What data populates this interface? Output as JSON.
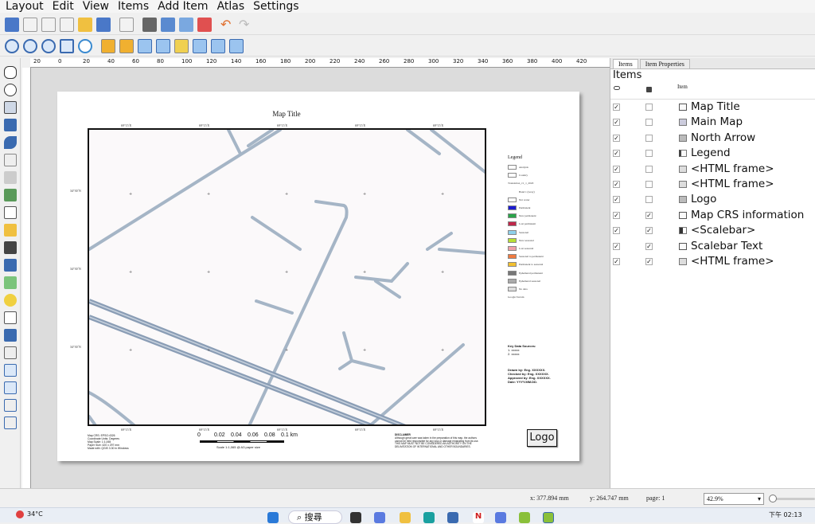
{
  "menu": [
    "Layout",
    "Edit",
    "View",
    "Items",
    "Add Item",
    "Atlas",
    "Settings"
  ],
  "layout": {
    "map_title": "Map Title",
    "top_ticks": [
      "69°15´E",
      "69°15´E",
      "69°15´E",
      "69°15´E",
      "69°15´E"
    ],
    "bottom_ticks": [
      "69°15´E",
      "69°15´E",
      "69°15´E",
      "69°15´E",
      "69°15´E"
    ],
    "left_ticks": [
      "34°30´N",
      "34°30´N",
      "34°30´N"
    ],
    "legend_title": "Legend",
    "legend_items": [
      {
        "label": "Analysis",
        "color": "#ffffff"
      },
      {
        "label": "Country",
        "color": "#ffffff"
      },
      {
        "label": "Translation_v1_1_2020",
        "color": ""
      },
      {
        "label": "Band 1 (Gray)",
        "color": ""
      },
      {
        "label": "Not water",
        "color": "#ffffff"
      },
      {
        "label": "Permanent",
        "color": "#1a1ad0"
      },
      {
        "label": "New permanent",
        "color": "#2aa44a"
      },
      {
        "label": "Lost permanent",
        "color": "#c0274a"
      },
      {
        "label": "Seasonal",
        "color": "#8ed0ea"
      },
      {
        "label": "New seasonal",
        "color": "#b8e034"
      },
      {
        "label": "Lost seasonal",
        "color": "#f0a0a8"
      },
      {
        "label": "Seasonal to permanent",
        "color": "#f07a40"
      },
      {
        "label": "Permanent to seasonal",
        "color": "#f2c030"
      },
      {
        "label": "Ephemeral permanent",
        "color": "#777777"
      },
      {
        "label": "Ephemeral seasonal",
        "color": "#aaaaaa"
      },
      {
        "label": "No data",
        "color": "#dddddd"
      },
      {
        "label": "Google Terrain",
        "color": ""
      }
    ],
    "key_sources_title": "Key Data Sources:",
    "key_sources": [
      "1. xxxxx",
      "2. xxxxx"
    ],
    "credits": [
      "Drawn by: Eng. XXXXXX.",
      "Checked by: Eng. XXXXXX.",
      "Approved by: Eng. XXXXXX.",
      "Date: YYYY.MM.DD."
    ],
    "crs_info": [
      "Map CRS: EPSG:4326",
      "Coordinate Units: Degrees",
      "Map Scale: 1:1,065",
      "Paper Size: 420 x 297 mm",
      "Made with: QGIS 3.30 in Windows"
    ],
    "scalebar_numbers": [
      "0",
      "0.02",
      "0.04",
      "0.06",
      "0.08",
      "0.1 km"
    ],
    "scalebar_text": "Scale 1:1,065 @ A3 paper size",
    "disclaimer_title": "DISCLAIMER",
    "disclaimer_text": [
      "Although great care was taken in the preparation of this map, the authors",
      "cannot be held responsible for any loss or damage emanating from its use.",
      "THIS MAP MUST NOT BE CONSIDERED AN AUTHORITY ON THE",
      "DELIMITATION OF INTERNATIONAL AND OTHER BOUNDARIES."
    ],
    "logo": "Logo"
  },
  "panel": {
    "tabs": [
      "Items",
      "Item Properties"
    ],
    "title": "Items",
    "col_item": "Item",
    "items": [
      {
        "name": "Map Title",
        "icon": "label-icon",
        "visible": true,
        "locked": false
      },
      {
        "name": "Main Map",
        "icon": "map-icon",
        "visible": true,
        "locked": false
      },
      {
        "name": "North Arrow",
        "icon": "picture-icon",
        "visible": true,
        "locked": false
      },
      {
        "name": "Legend",
        "icon": "legend-icon",
        "visible": true,
        "locked": false
      },
      {
        "name": "<HTML frame>",
        "icon": "html-icon",
        "visible": true,
        "locked": false
      },
      {
        "name": "<HTML frame>",
        "icon": "html-icon",
        "visible": true,
        "locked": false
      },
      {
        "name": "Logo",
        "icon": "picture-icon",
        "visible": true,
        "locked": false
      },
      {
        "name": "Map CRS information",
        "icon": "label-icon",
        "visible": true,
        "locked": true
      },
      {
        "name": "<Scalebar>",
        "icon": "scalebar-icon",
        "visible": true,
        "locked": true
      },
      {
        "name": "Scalebar Text",
        "icon": "label-icon",
        "visible": true,
        "locked": true
      },
      {
        "name": "<HTML frame>",
        "icon": "html-icon",
        "visible": true,
        "locked": true
      }
    ]
  },
  "status": {
    "x": "x: 377.894 mm",
    "y": "y: 264.747 mm",
    "page": "page: 1",
    "zoom": "42.9%"
  },
  "taskbar": {
    "weather_temp": "34°C",
    "search": "搜尋",
    "time": "下午 02:13"
  },
  "ruler": [
    "20",
    "0",
    "20",
    "40",
    "60",
    "80",
    "100",
    "120",
    "140",
    "160",
    "180",
    "200",
    "220",
    "240",
    "260",
    "280",
    "300",
    "320",
    "340",
    "360",
    "380",
    "400",
    "420"
  ]
}
